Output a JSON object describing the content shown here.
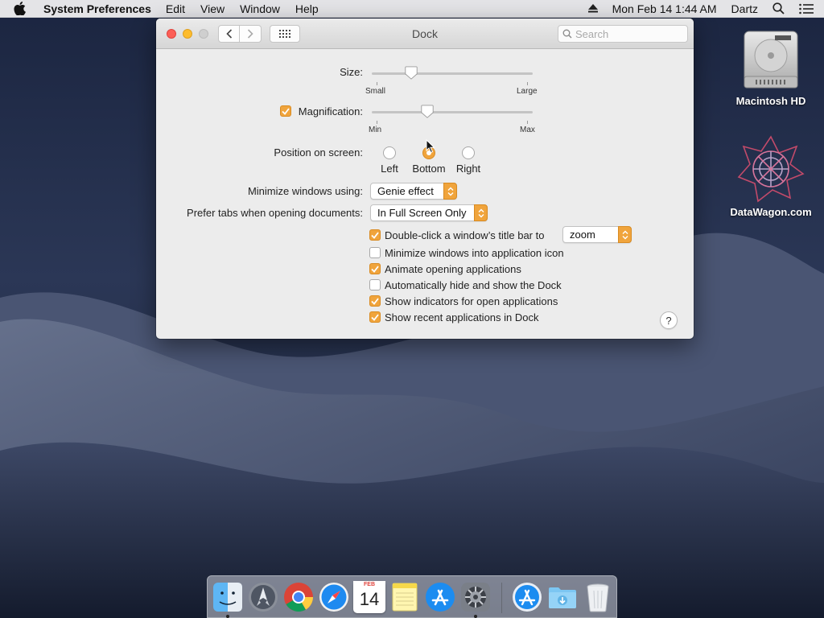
{
  "menubar": {
    "app_name": "System Preferences",
    "menus": [
      "Edit",
      "View",
      "Window",
      "Help"
    ],
    "datetime": "Mon Feb 14  1:44 AM",
    "user": "Dartz"
  },
  "desktop": {
    "icons": [
      {
        "label": "Macintosh HD",
        "icon": "hard-drive-icon"
      },
      {
        "label": "DataWagon.com",
        "icon": "datawagon-logo-icon"
      }
    ]
  },
  "window": {
    "title": "Dock",
    "search_placeholder": "Search"
  },
  "dock_prefs": {
    "size": {
      "label": "Size:",
      "min_label": "Small",
      "max_label": "Large",
      "value": 0.25
    },
    "magnification": {
      "label": "Magnification:",
      "checked": true,
      "min_label": "Min",
      "max_label": "Max",
      "value": 0.35
    },
    "position": {
      "label": "Position on screen:",
      "options": [
        "Left",
        "Bottom",
        "Right"
      ],
      "selected": "Bottom"
    },
    "minimize": {
      "label": "Minimize windows using:",
      "value": "Genie effect"
    },
    "prefer_tabs": {
      "label": "Prefer tabs when opening documents:",
      "value": "In Full Screen Only"
    },
    "double_click": {
      "label": "Double-click a window’s title bar to",
      "checked": true,
      "value": "zoom"
    },
    "checkboxes": [
      {
        "label": "Minimize windows into application icon",
        "checked": false
      },
      {
        "label": "Animate opening applications",
        "checked": true
      },
      {
        "label": "Automatically hide and show the Dock",
        "checked": false
      },
      {
        "label": "Show indicators for open applications",
        "checked": true
      },
      {
        "label": "Show recent applications in Dock",
        "checked": true
      }
    ],
    "help_label": "?"
  },
  "dock": {
    "apps": [
      "Finder",
      "Launchpad",
      "Chrome",
      "Safari",
      "Calendar",
      "Notes",
      "App Store",
      "System Preferences",
      "App Store",
      "Downloads",
      "Trash"
    ],
    "calendar": {
      "month": "FEB",
      "day": "14"
    }
  },
  "colors": {
    "accent": "#f0a43c",
    "close": "#fc5f57",
    "minimize": "#fdbc2e"
  }
}
